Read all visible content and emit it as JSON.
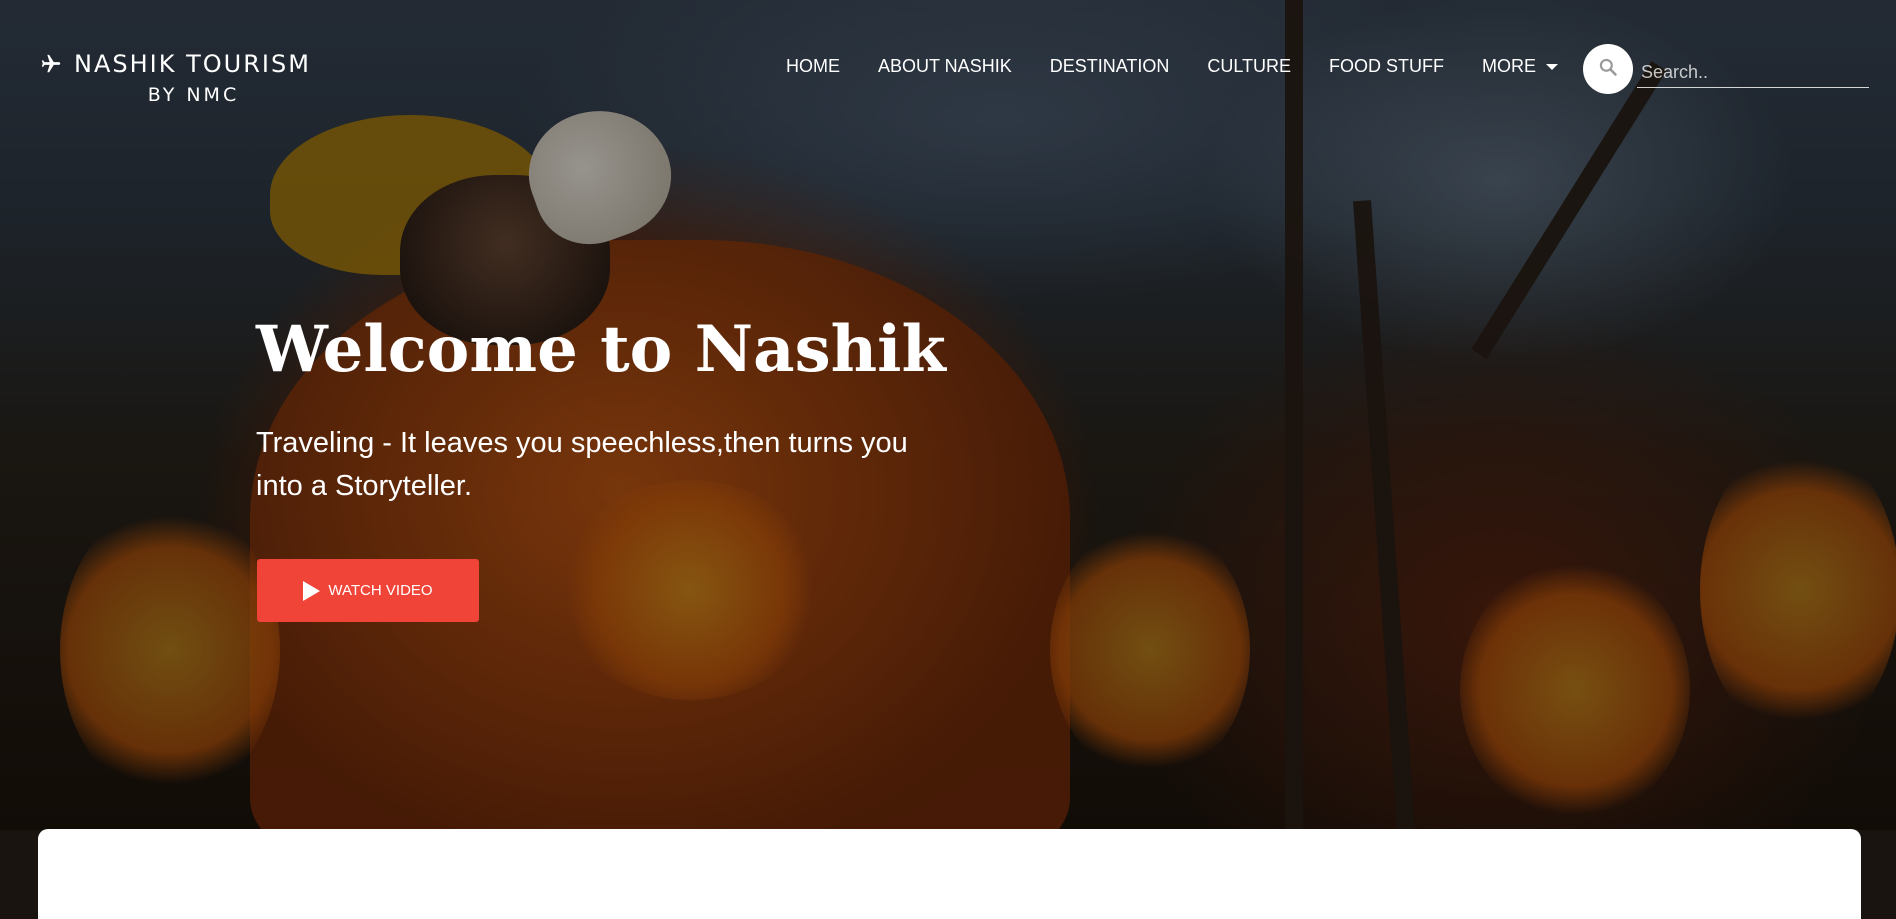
{
  "brand": {
    "line1": "NASHIK TOURISM",
    "line2": "BY NMC",
    "icon": "airplane-icon"
  },
  "nav": {
    "items": [
      {
        "label": "HOME"
      },
      {
        "label": "ABOUT NASHIK"
      },
      {
        "label": "DESTINATION"
      },
      {
        "label": "CULTURE"
      },
      {
        "label": "FOOD STUFF"
      },
      {
        "label": "MORE",
        "has_dropdown": true
      }
    ]
  },
  "search": {
    "placeholder": "Search..",
    "value": "",
    "icon": "search-icon"
  },
  "hero": {
    "title": "Welcome to Nashik",
    "subtitle": "Traveling - It leaves you speechless,then turns you into a Storyteller.",
    "button_label": "WATCH VIDEO",
    "button_icon": "play-icon"
  },
  "colors": {
    "accent": "#f04438",
    "text": "#ffffff",
    "card": "#ffffff"
  }
}
